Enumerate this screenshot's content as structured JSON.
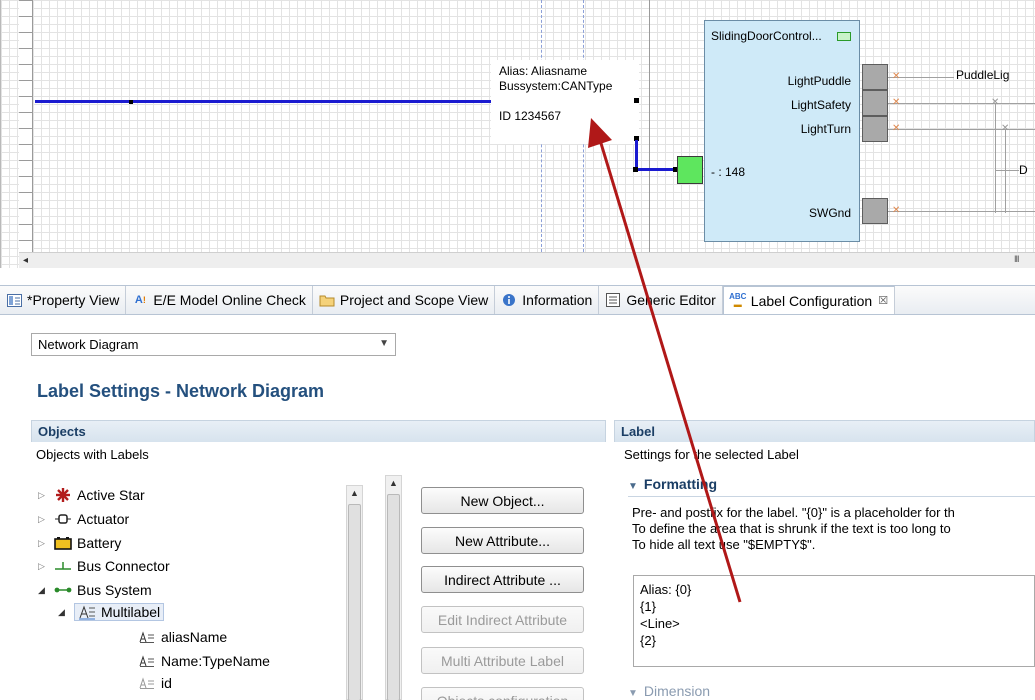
{
  "diagram": {
    "label_box": {
      "lines": [
        "Alias: Aliasname",
        "Bussystem:CANType",
        "",
        "ID 1234567"
      ]
    },
    "ecu": {
      "title": "SlidingDoorControl...",
      "pins": [
        "LightPuddle",
        "LightSafety",
        "LightTurn",
        "SWGnd"
      ],
      "port_label": "- : 148"
    },
    "signal_label_puddle": "PuddleLig",
    "signal_label_d": "D",
    "scroll_grip": "III",
    "colors": {
      "bus": "#1b1bd0",
      "ecu_fill": "#cfeaf8",
      "port_green": "#5ee65e",
      "arrow": "#b01818"
    }
  },
  "tabs": [
    {
      "label": "*Property View",
      "icon": "property-view-icon"
    },
    {
      "label": "E/E Model Online Check",
      "icon": "model-check-icon"
    },
    {
      "label": "Project and Scope View",
      "icon": "folder-icon"
    },
    {
      "label": "Information",
      "icon": "info-icon"
    },
    {
      "label": "Generic Editor",
      "icon": "generic-editor-icon"
    },
    {
      "label": "Label Configuration",
      "icon": "abc-label-icon",
      "active": true
    }
  ],
  "diagram_type_select": {
    "value": "Network Diagram"
  },
  "section_title": "Label Settings - Network Diagram",
  "objects_panel": {
    "header": "Objects",
    "subtitle": "Objects with Labels",
    "tree": [
      {
        "label": "Active Star",
        "icon": "active-star-icon",
        "expanded": false,
        "level": 0
      },
      {
        "label": "Actuator",
        "icon": "actuator-icon",
        "expanded": false,
        "level": 0
      },
      {
        "label": "Battery",
        "icon": "battery-icon",
        "expanded": false,
        "level": 0
      },
      {
        "label": "Bus Connector",
        "icon": "bus-connector-icon",
        "expanded": false,
        "level": 0
      },
      {
        "label": "Bus System",
        "icon": "bus-system-icon",
        "expanded": true,
        "level": 0
      },
      {
        "label": "Multilabel",
        "icon": "multilabel-icon",
        "expanded": true,
        "level": 1,
        "selected": true
      },
      {
        "label": "aliasName",
        "icon": "attribute-icon",
        "level": 2
      },
      {
        "label": "Name:TypeName",
        "icon": "attribute-icon",
        "level": 2
      },
      {
        "label": "id",
        "icon": "attribute-icon",
        "level": 2
      }
    ]
  },
  "buttons": {
    "new_object": "New Object...",
    "new_attribute": "New Attribute...",
    "indirect_attribute": "Indirect Attribute ...",
    "edit_indirect_attribute": "Edit Indirect Attribute",
    "multi_attribute_label": "Multi Attribute Label",
    "objects_configuration": "Objects configuration"
  },
  "label_panel": {
    "header": "Label",
    "subtitle": "Settings for the selected Label",
    "formatting_header": "Formatting",
    "description": [
      "Pre- and postfix for the label. \"{0}\" is a placeholder for th",
      "To define the area that is shrunk if the text is too long to",
      "To hide all text use \"$EMPTY$\"."
    ],
    "format_text": [
      "Alias: {0}",
      "{1}",
      "<Line>",
      "{2}"
    ],
    "dimension_header": "Dimension"
  }
}
